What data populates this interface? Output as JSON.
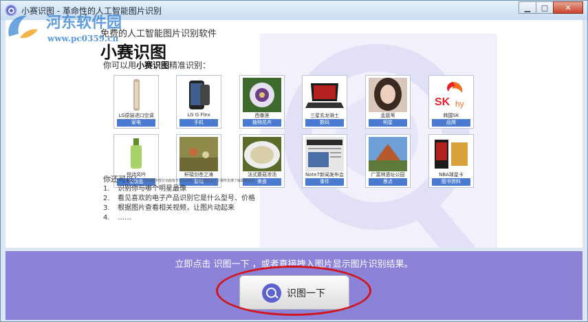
{
  "window": {
    "title": "小赛识图 - 革命性的人工智能图片识别"
  },
  "watermark": {
    "text": "河东软件园",
    "url": "www.pc0359.cn"
  },
  "window_buttons": {
    "minimize": "▁",
    "maximize": "□",
    "close": "✕"
  },
  "header": {
    "subtitle": "免费的人工智能图片识别软件",
    "title": "小赛识图"
  },
  "lead": {
    "prefix": "你可以用",
    "app": "小赛识图",
    "suffix": "精准识别："
  },
  "cards": [
    {
      "name": "LG原装进口空调",
      "category": "家电"
    },
    {
      "name": "LG G Flex",
      "category": "手机"
    },
    {
      "name": "西番莲",
      "category": "植物花卉"
    },
    {
      "name": "三星玄龙骑士",
      "category": "数码"
    },
    {
      "name": "孟庭苇",
      "category": "明星"
    },
    {
      "name": "韩国SK",
      "category": "品牌"
    },
    {
      "name": "悦诗风吟",
      "category": "化妆品"
    },
    {
      "name": "轩辕剑苍之涛",
      "category": "游戏"
    },
    {
      "name": "法式蘑菇浓汤",
      "category": "美食"
    },
    {
      "name": "Note7新闻发布会",
      "category": "事件"
    },
    {
      "name": "广富林遗址公园",
      "category": "景点"
    },
    {
      "name": "NBA球星卡",
      "category": "图书资料"
    }
  ],
  "more": {
    "label": "你还可以：",
    "note": "下列功能中部分功能有于以后实现，欢迎感谢关注小赛所支撑了解最新动态",
    "items": [
      {
        "num": "1.",
        "text": "识别你与哪个明星最像"
      },
      {
        "num": "2.",
        "text": "看见喜欢的电子产品识别它是什么型号、价格"
      },
      {
        "num": "3.",
        "text": "根据图片查看相关视频，让图片动起来"
      },
      {
        "num": "4.",
        "text": "……"
      }
    ]
  },
  "bottom": {
    "hint": "立即点击 识图一下 ，或者直接拽入图片显示图片识别结果。",
    "button_label": "识图一下"
  },
  "colors": {
    "accent": "#8b83d8",
    "category_bg": "#4a7bd0",
    "highlight": "#d2141a"
  }
}
